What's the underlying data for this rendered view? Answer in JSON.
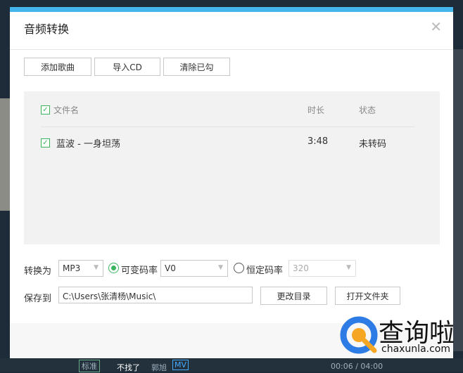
{
  "dialog": {
    "title": "音频转换"
  },
  "toolbar": {
    "add_songs": "添加歌曲",
    "import_cd": "导入CD",
    "clear_checked": "清除已勾"
  },
  "table": {
    "headers": {
      "filename": "文件名",
      "duration": "时长",
      "status": "状态"
    },
    "rows": [
      {
        "checked": true,
        "filename": "蓝波 - 一身坦荡",
        "duration": "3:48",
        "status": "未转码"
      }
    ]
  },
  "convert": {
    "label": "转换为",
    "format": "MP3",
    "vbr_label": "可变码率",
    "vbr_value": "V0",
    "cbr_label": "恒定码率",
    "cbr_value": "320",
    "mode": "vbr"
  },
  "save": {
    "label": "保存到",
    "path": "C:\\Users\\张清杨\\Music\\",
    "change_dir": "更改目录",
    "open_folder": "打开文件夹"
  },
  "watermark": {
    "brand": "查询啦",
    "domain": "chaxunla.com"
  },
  "player": {
    "quality": "标准",
    "song": "不找了",
    "artist": "郭旭",
    "mv": "MV",
    "time": "00:06 / 04:00"
  },
  "colors": {
    "accent": "#45b6ec",
    "check": "#3cb55f"
  }
}
